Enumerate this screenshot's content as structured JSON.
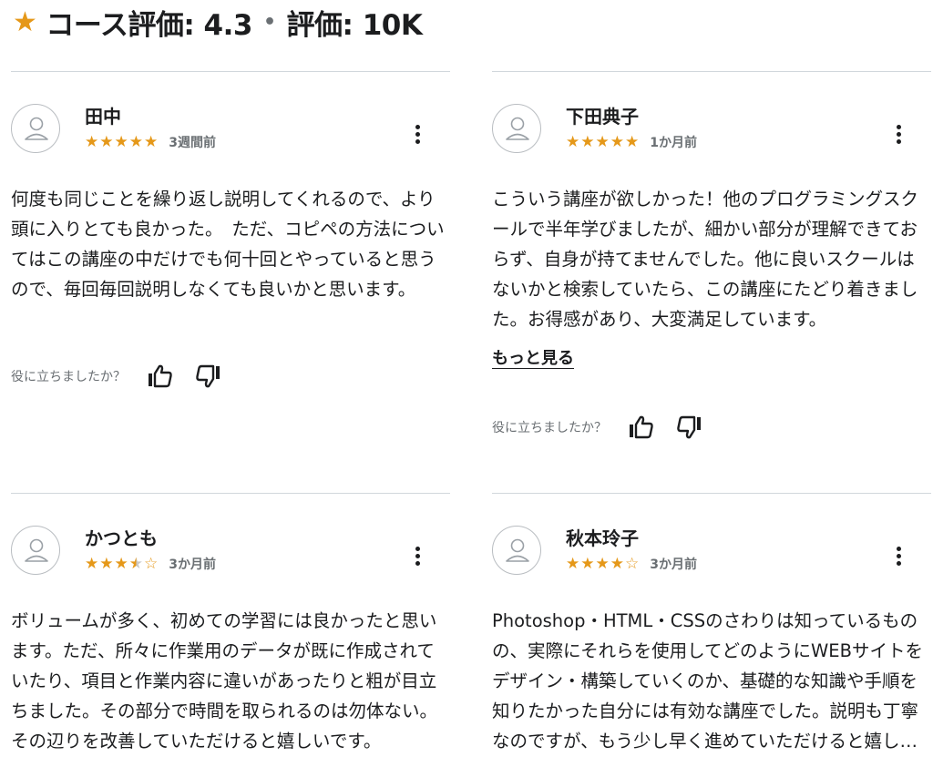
{
  "header": {
    "star_icon": "star-icon",
    "course_rating": "コース評価: 4.3",
    "separator": "•",
    "rating_count": "評価: 10K"
  },
  "colors": {
    "star": "#e59819",
    "text": "#1c1d1f",
    "muted": "#6a6f73",
    "divider": "#d1d7dc"
  },
  "helpful_label": "役に立ちましたか？",
  "see_more_label": "もっと見る",
  "reviews": [
    {
      "name": "田中",
      "rating": 5,
      "date": "3週間前",
      "text": "何度も同じことを繰り返し説明してくれるので、より頭に入りとても良かった。　ただ、コピペの方法についてはこの講座の中だけでも何十回とやっていると思うので、毎回毎回説明しなくても良いかと思います。",
      "truncated": false
    },
    {
      "name": "下田典子",
      "rating": 5,
      "date": "1か月前",
      "text": "こういう講座が欲しかった！他のプログラミングスクールで半年学びましたが、細かい部分が理解できておらず、自身が持てませんでした。他に良いスクールはないかと検索していたら、この講座にたどり着きました。お得感があり、大変満足しています。",
      "truncated": true
    },
    {
      "name": "かつとも",
      "rating": 3.5,
      "date": "3か月前",
      "text": "ボリュームが多く、初めての学習には良かったと思います。ただ、所々に作業用のデータが既に作成されていたり、項目と作業内容に違いがあったりと粗が目立ちました。その部分で時間を取られるのは勿体ない。その辺りを改善していただけると嬉しいです。",
      "truncated": true
    },
    {
      "name": "秋本玲子",
      "rating": 4,
      "date": "3か月前",
      "text": "Photoshop・HTML・CSSのさわりは知っているものの、実際にそれらを使用してどのようにWEBサイトをデザイン・構築していくのか、基礎的な知識や手順を知りたかった自分には有効な講座でした。説明も丁寧なのですが、もう少し早く進めていただけると嬉しいです。",
      "truncated": true
    }
  ]
}
